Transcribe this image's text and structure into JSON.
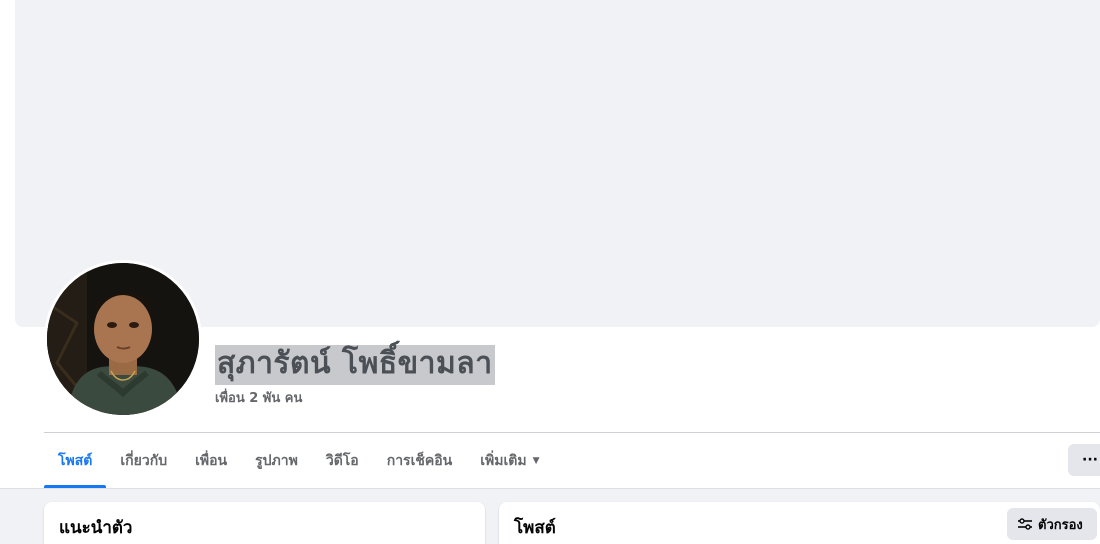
{
  "profile": {
    "name": "สุภารัตน์ โพธิ์ขามลา",
    "friends_count": "เพื่อน 2 พัน คน"
  },
  "tabs": [
    {
      "label": "โพสต์",
      "active": true
    },
    {
      "label": "เกี่ยวกับ"
    },
    {
      "label": "เพื่อน"
    },
    {
      "label": "รูปภาพ"
    },
    {
      "label": "วิดีโอ"
    },
    {
      "label": "การเช็คอิน"
    },
    {
      "label": "เพิ่มเติม"
    }
  ],
  "more_button": "···",
  "intro_card": {
    "title": "แนะนำตัว"
  },
  "posts_card": {
    "title": "โพสต์",
    "filter_label": "ตัวกรอง",
    "filter_icon": "sliders-icon"
  },
  "colors": {
    "accent": "#1877f2",
    "cover": "#f0f2f5",
    "button_bg": "#e4e6eb"
  }
}
